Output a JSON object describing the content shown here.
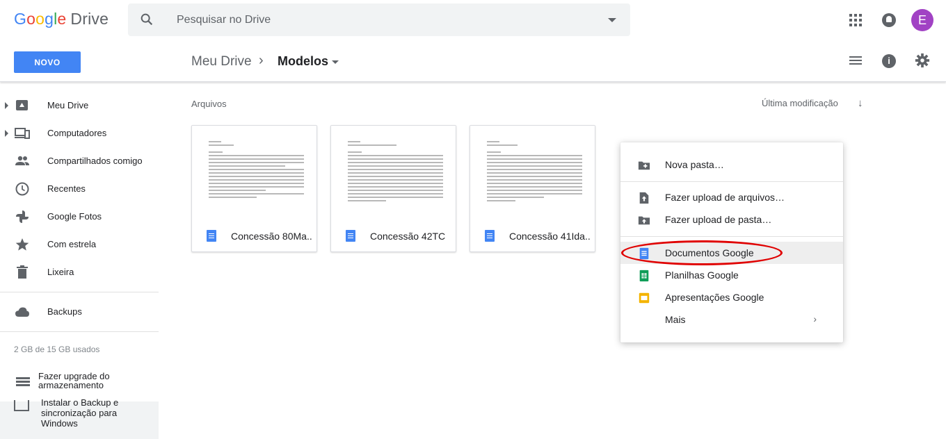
{
  "app": {
    "logo_google": [
      "G",
      "o",
      "o",
      "g",
      "l",
      "e"
    ],
    "logo_drive": "Drive"
  },
  "search": {
    "placeholder": "Pesquisar no Drive"
  },
  "header": {
    "avatar_letter": "E"
  },
  "toolbar": {
    "new_label": "NOVO",
    "breadcrumb_root": "Meu Drive",
    "breadcrumb_sep": "›",
    "breadcrumb_current": "Modelos",
    "info_glyph": "i"
  },
  "sidebar": {
    "items": [
      {
        "label": "Meu Drive",
        "icon": "drive-icon"
      },
      {
        "label": "Computadores",
        "icon": "computers-icon"
      },
      {
        "label": "Compartilhados comigo",
        "icon": "shared-people-icon"
      },
      {
        "label": "Recentes",
        "icon": "clock-icon"
      },
      {
        "label": "Google Fotos",
        "icon": "photos-pinwheel-icon"
      },
      {
        "label": "Com estrela",
        "icon": "star-icon"
      },
      {
        "label": "Lixeira",
        "icon": "trash-icon"
      }
    ],
    "backups": {
      "label": "Backups",
      "icon": "cloud-icon"
    },
    "storage_text": "2 GB de 15 GB usados",
    "upgrade_label": "Fazer upgrade do armazenamento",
    "install_backup_label": "Instalar o Backup e sincronização para Windows"
  },
  "main": {
    "section_label": "Arquivos",
    "sort_label": "Última modificação",
    "sort_arrow": "↓",
    "files": [
      {
        "name": "Concessão 80Ma...",
        "icon": "google-docs-icon"
      },
      {
        "name": "Concessão 42TC",
        "icon": "google-docs-icon"
      },
      {
        "name": "Concessão 41Ida...",
        "icon": "google-docs-icon"
      }
    ]
  },
  "new_menu": {
    "items": [
      {
        "label": "Nova pasta…",
        "icon": "new-folder-icon"
      },
      {
        "label": "Fazer upload de arquivos…",
        "icon": "file-upload-icon"
      },
      {
        "label": "Fazer upload de pasta…",
        "icon": "folder-upload-icon"
      },
      {
        "label": "Documentos Google",
        "icon": "google-docs-icon"
      },
      {
        "label": "Planilhas Google",
        "icon": "google-sheets-icon"
      },
      {
        "label": "Apresentações Google",
        "icon": "google-slides-icon"
      },
      {
        "label": "Mais",
        "icon": "chevron-right-icon"
      }
    ],
    "more_chevron": "›",
    "highlighted_index": 3
  },
  "colors": {
    "accent": "#4285f4",
    "avatar": "#a142c4",
    "annotation": "#e00000",
    "sheets": "#0f9d58",
    "slides": "#f4b400"
  }
}
